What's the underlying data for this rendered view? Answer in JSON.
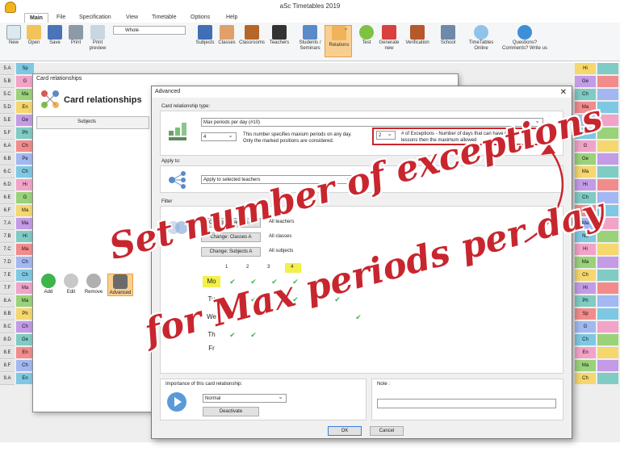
{
  "app": {
    "title": "aSc Timetables 2019"
  },
  "menu": [
    "Main",
    "File",
    "Specification",
    "View",
    "Timetable",
    "Options",
    "Help"
  ],
  "ribbon": {
    "left_buttons": [
      "New",
      "Open",
      "Save",
      "Print",
      "Print preview"
    ],
    "view_select": "Whole",
    "right_buttons": [
      "Subjects",
      "Classes",
      "Classrooms",
      "Teachers",
      "Students / Seminars",
      "Relations",
      "Test",
      "Generate new",
      "Verification",
      "School",
      "TimeTables Online",
      "Questions? Comments? Write us"
    ]
  },
  "grid": {
    "rows": [
      "5.A",
      "5.B",
      "5.C",
      "5.D",
      "5.E",
      "5.F",
      "6.A",
      "6.B",
      "6.C",
      "6.D",
      "6.E",
      "6.F",
      "7.A",
      "7.B",
      "7.C",
      "7.D",
      "7.E",
      "7.F",
      "8.A",
      "8.B",
      "8.C",
      "8.D",
      "8.E",
      "8.F",
      "9.A"
    ],
    "cells_left": [
      "Sp",
      "G",
      "Ma",
      "En",
      "Ge",
      "Ph",
      "Ch",
      "Pe",
      "Ch",
      "Hi",
      "G",
      "Ma",
      "Ma",
      "Hi",
      "Ma",
      "Ch",
      "Ch",
      "Ma",
      "Ma",
      "Ph",
      "Ch",
      "Ge",
      "En",
      "Ch",
      "En"
    ],
    "cells_right": [
      "Hi",
      "Ge",
      "Ch",
      "Ma",
      "G",
      "Hi",
      "G",
      "Ge",
      "Ma",
      "Hi",
      "Ch",
      "Ph",
      "Ma",
      "Na",
      "Hi",
      "Ma",
      "Ch",
      "Hi",
      "Ph",
      "Sp",
      "G",
      "Ch",
      "En",
      "Ma",
      "Ch"
    ]
  },
  "card_window": {
    "title": "Card relationships",
    "heading": "Card relationships",
    "column": "Subjects",
    "buttons": [
      "Add",
      "Edit",
      "Remove",
      "Advanced"
    ]
  },
  "advanced": {
    "title": "Advanced",
    "type_label": "Card relationship type:",
    "type_value": "Max periods per day (#10)",
    "max_value": "4",
    "max_desc_line1": "This number specifies maxium periods on any day.",
    "max_desc_line2": "Only the marked positions are considered.",
    "exceptions_value": "2",
    "exceptions_desc_line1": "# of Exceptions - Number of days that can have more",
    "exceptions_desc_line2": "lessons then the maximum allowed",
    "apply_label": "Apply to:",
    "apply_value": "Apply to selected teachers",
    "filter_label": "Filter",
    "filters": [
      {
        "button": "Change: Teachers A",
        "value": "All teachers"
      },
      {
        "button": "Change: Classes A",
        "value": "All classes"
      },
      {
        "button": "Change: Subjects A",
        "value": "All subjects"
      }
    ],
    "days": [
      "Mo",
      "Tu",
      "We",
      "Th",
      "Fr"
    ],
    "periods": [
      "1",
      "2",
      "3",
      "4",
      "5",
      "6",
      "7",
      "8"
    ],
    "importance_label": "Importance of this card relationship:",
    "importance_value": "Normal",
    "deactivate": "Deactivate",
    "note_label": "Note :",
    "ok": "OK",
    "cancel": "Cancel"
  },
  "annotation": {
    "line1": "Set number of exceptions",
    "line2": "for Max periods per day",
    "color": "#c8262e"
  }
}
